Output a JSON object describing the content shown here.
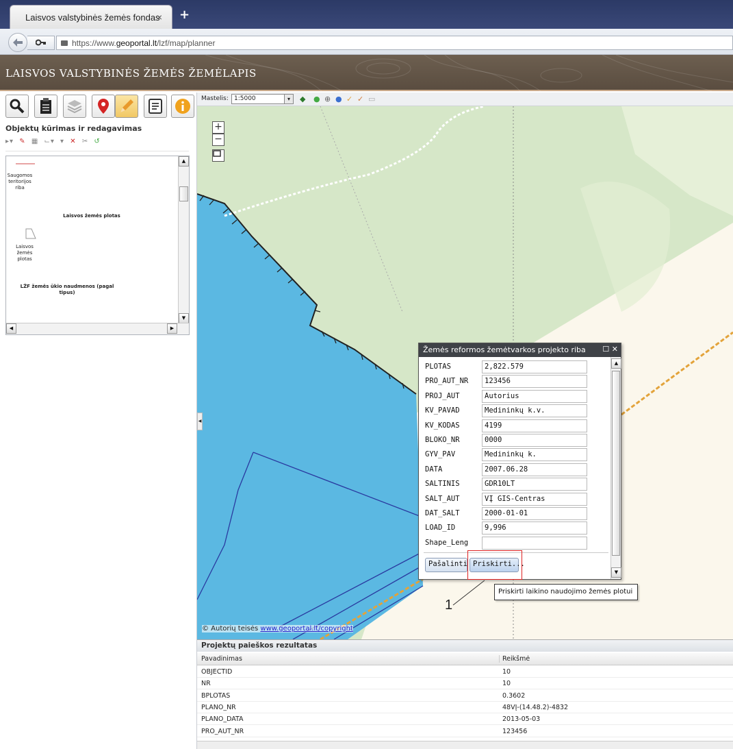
{
  "browser": {
    "tab_title": "Laisvos valstybinės žemės fondas",
    "tab_close": "×",
    "new_tab": "+",
    "url_prefix": "https://www.",
    "url_domain": "geoportal.lt",
    "url_path": "/lzf/map/planner"
  },
  "app": {
    "title": "LAISVOS VALSTYBINĖS ŽEMĖS ŽEMĖLAPIS"
  },
  "left_panel": {
    "tools": [
      "search-icon",
      "clipboard-icon",
      "layers-icon",
      "location-pin-icon",
      "pencil-icon",
      "form-icon",
      "info-icon"
    ],
    "section_title": "Objektų kūrimas ir redagavimas",
    "legend": {
      "item1": "Saugomos teritorijos riba",
      "item2_header": "Laisvos žemės plotas",
      "item2": "Laisvos žemės plotas",
      "item3_header": "LŽF žemės ūkio naudmenos (pagal tipus)"
    }
  },
  "map_toolbar": {
    "scale_label": "Mastelis:",
    "scale_value": "1:5000"
  },
  "map": {
    "zoom_in": "+",
    "zoom_out": "−",
    "copyright_prefix": "© Autorių teisės ",
    "copyright_link": "www.geoportal.lt/copyright",
    "colors": {
      "forest": "#d6e7c8",
      "water": "#5bb8e2",
      "field": "#fbf7ec"
    }
  },
  "popup": {
    "title": "Žemės reformos žemėtvarkos projekto riba",
    "fields": [
      {
        "label": "PLOTAS",
        "value": "2,822.579"
      },
      {
        "label": "PRO_AUT_NR",
        "value": "123456"
      },
      {
        "label": "PROJ_AUT",
        "value": "Autorius"
      },
      {
        "label": "KV_PAVAD",
        "value": "Medininkų k.v."
      },
      {
        "label": "KV_KODAS",
        "value": "4199"
      },
      {
        "label": "BLOKO_NR",
        "value": "0000"
      },
      {
        "label": "GYV_PAV",
        "value": "Medininkų k."
      },
      {
        "label": "DATA",
        "value": "2007.06.28"
      },
      {
        "label": "SALTINIS",
        "value": "GDR10LT"
      },
      {
        "label": "SALT_AUT",
        "value": "VĮ GIS-Centras"
      },
      {
        "label": "DAT_SALT",
        "value": "2000-01-01"
      },
      {
        "label": "LOAD_ID",
        "value": "9,996"
      },
      {
        "label": "Shape_Leng",
        "value": ""
      }
    ],
    "remove_label": "Pašalinti",
    "assign_label": "Priskirti...",
    "tooltip": "Priskirti laikino naudojimo žemės plotui",
    "callout_number": "1"
  },
  "results": {
    "title": "Projektų paieškos rezultatas",
    "columns": [
      "Pavadinimas",
      "Reikšmė"
    ],
    "rows": [
      [
        "OBJECTID",
        "10"
      ],
      [
        "NR",
        "10"
      ],
      [
        "BPLOTAS",
        "0.3602"
      ],
      [
        "PLANO_NR",
        "48VĮ-(14.48.2)-4832"
      ],
      [
        "PLANO_DATA",
        "2013-05-03"
      ],
      [
        "PRO_AUT_NR",
        "123456"
      ]
    ]
  }
}
